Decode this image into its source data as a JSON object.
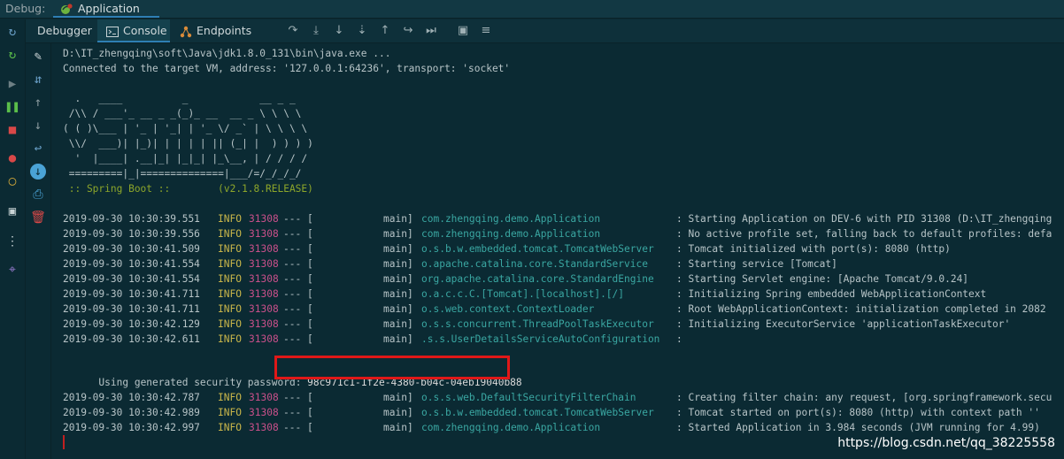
{
  "window": {
    "debug_label": "Debug:",
    "run_tab": "Application"
  },
  "toolbar": {
    "tabs": [
      "Debugger",
      "Console",
      "Endpoints"
    ],
    "active_tab": "Console"
  },
  "console": {
    "command_line": "D:\\IT_zhengqing\\soft\\Java\\jdk1.8.0_131\\bin\\java.exe ...",
    "connected": "Connected to the target VM, address: '127.0.0.1:64236', transport: 'socket'",
    "banner": [
      "  .   ____          _            __ _ _",
      " /\\\\ / ___'_ __ _ _(_)_ __  __ _ \\ \\ \\ \\",
      "( ( )\\___ | '_ | '_| | '_ \\/ _` | \\ \\ \\ \\",
      " \\\\/  ___)| |_)| | | | | || (_| |  ) ) ) )",
      "  '  |____| .__|_| |_|_| |_\\__, | / / / /",
      " =========|_|==============|___/=/_/_/_/"
    ],
    "spring_line": " :: Spring Boot ::        (v2.1.8.RELEASE)",
    "logs_1": [
      {
        "ts": "2019-09-30 10:30:39.551",
        "level": "INFO",
        "pid": "31308",
        "sep": "--- [",
        "thread": "main]",
        "logger": "com.zhengqing.demo.Application",
        "msg": ": Starting Application on DEV-6 with PID 31308 (D:\\IT_zhengqing"
      },
      {
        "ts": "2019-09-30 10:30:39.556",
        "level": "INFO",
        "pid": "31308",
        "sep": "--- [",
        "thread": "main]",
        "logger": "com.zhengqing.demo.Application",
        "msg": ": No active profile set, falling back to default profiles: defa"
      },
      {
        "ts": "2019-09-30 10:30:41.509",
        "level": "INFO",
        "pid": "31308",
        "sep": "--- [",
        "thread": "main]",
        "logger": "o.s.b.w.embedded.tomcat.TomcatWebServer",
        "msg": ": Tomcat initialized with port(s): 8080 (http)"
      },
      {
        "ts": "2019-09-30 10:30:41.554",
        "level": "INFO",
        "pid": "31308",
        "sep": "--- [",
        "thread": "main]",
        "logger": "o.apache.catalina.core.StandardService",
        "msg": ": Starting service [Tomcat]"
      },
      {
        "ts": "2019-09-30 10:30:41.554",
        "level": "INFO",
        "pid": "31308",
        "sep": "--- [",
        "thread": "main]",
        "logger": "org.apache.catalina.core.StandardEngine",
        "msg": ": Starting Servlet engine: [Apache Tomcat/9.0.24]"
      },
      {
        "ts": "2019-09-30 10:30:41.711",
        "level": "INFO",
        "pid": "31308",
        "sep": "--- [",
        "thread": "main]",
        "logger": "o.a.c.c.C.[Tomcat].[localhost].[/]",
        "msg": ": Initializing Spring embedded WebApplicationContext"
      },
      {
        "ts": "2019-09-30 10:30:41.711",
        "level": "INFO",
        "pid": "31308",
        "sep": "--- [",
        "thread": "main]",
        "logger": "o.s.web.context.ContextLoader",
        "msg": ": Root WebApplicationContext: initialization completed in 2082"
      },
      {
        "ts": "2019-09-30 10:30:42.129",
        "level": "INFO",
        "pid": "31308",
        "sep": "--- [",
        "thread": "main]",
        "logger": "o.s.s.concurrent.ThreadPoolTaskExecutor",
        "msg": ": Initializing ExecutorService 'applicationTaskExecutor'"
      },
      {
        "ts": "2019-09-30 10:30:42.611",
        "level": "INFO",
        "pid": "31308",
        "sep": "--- [",
        "thread": "main]",
        "logger": ".s.s.UserDetailsServiceAutoConfiguration",
        "msg": ":"
      }
    ],
    "password_label": "Using generated security password: ",
    "password_value": "98c971c1-1f2e-4380-b04c-04eb19040b88",
    "logs_2": [
      {
        "ts": "2019-09-30 10:30:42.787",
        "level": "INFO",
        "pid": "31308",
        "sep": "--- [",
        "thread": "main]",
        "logger": "o.s.s.web.DefaultSecurityFilterChain",
        "msg": ": Creating filter chain: any request, [org.springframework.secu"
      },
      {
        "ts": "2019-09-30 10:30:42.989",
        "level": "INFO",
        "pid": "31308",
        "sep": "--- [",
        "thread": "main]",
        "logger": "o.s.b.w.embedded.tomcat.TomcatWebServer",
        "msg": ": Tomcat started on port(s): 8080 (http) with context path ''"
      },
      {
        "ts": "2019-09-30 10:30:42.997",
        "level": "INFO",
        "pid": "31308",
        "sep": "--- [",
        "thread": "main]",
        "logger": "com.zhengqing.demo.Application",
        "msg": ": Started Application in 3.984 seconds (JVM running for 4.99)"
      }
    ]
  },
  "watermark": "https://blog.csdn.net/qq_38225558",
  "colors": {
    "background": "#0b2a33",
    "info": "#c9b64a",
    "pid": "#c9508a",
    "logger": "#3aa7a2",
    "highlight_box": "#e01818",
    "accent": "#2e7fb4"
  }
}
